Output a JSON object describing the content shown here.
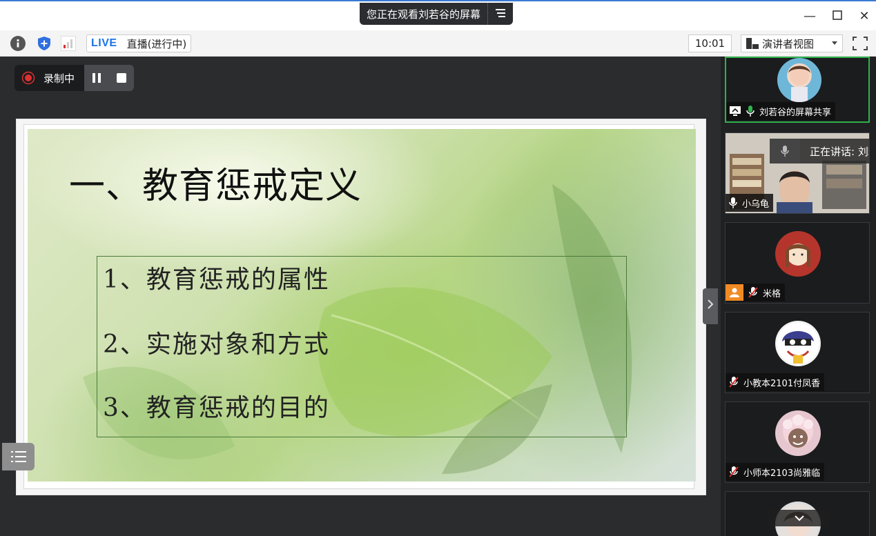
{
  "window": {
    "share_banner": "您正在观看刘若谷的屏幕",
    "banner_menu_icon": "menu-icon",
    "minimize_glyph": "—",
    "maximize_glyph": "☐",
    "close_glyph": "✕"
  },
  "toolbar": {
    "live_label": "LIVE",
    "live_status": "直播(进行中)",
    "time": "10:01",
    "view_mode": "演讲者视图"
  },
  "recording": {
    "label": "录制中"
  },
  "slide": {
    "title": "一、教育惩戒定义",
    "items": [
      "1、教育惩戒的属性",
      "2、实施对象和方式",
      "3、教育惩戒的目的"
    ]
  },
  "participants": [
    {
      "name": "刘若谷的屏幕共享",
      "mic": "on",
      "sharing": true
    },
    {
      "name": "小乌龟",
      "mic": "on",
      "speaking_label": "正在讲话: 刘若"
    },
    {
      "name": "米格",
      "mic": "muted"
    },
    {
      "name": "小教本2101付凤香",
      "mic": "muted"
    },
    {
      "name": "小师本2103尚雅临",
      "mic": "muted"
    }
  ],
  "colors": {
    "accent_green": "#2fb24c",
    "live_blue": "#1a73e8",
    "record_red": "#e03030",
    "shield_blue": "#2f6fe0"
  }
}
